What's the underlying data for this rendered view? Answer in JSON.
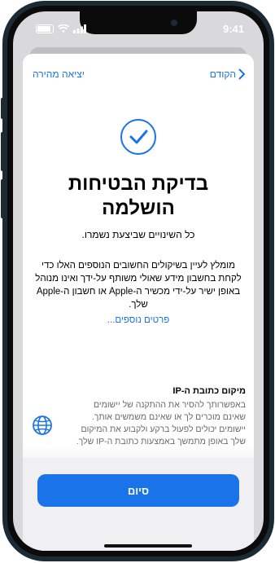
{
  "status_bar": {
    "time": "9:41"
  },
  "nav": {
    "back_label": "הקודם",
    "quick_exit_label": "יציאה מהירה"
  },
  "main": {
    "title_line1": "בדיקת הבטיחות",
    "title_line2": "הושלמה",
    "subtitle": "כל השינויים שביצעת נשמרו.",
    "body": "מומלץ לעיין בשיקולים החשובים הנוספים האלו כדי לקחת בחשבון מידע שאולי משותף על-ידך ואינו מנוהל באופן ישיר על-ידי מכשיר ה-Apple או חשבון ה-Apple שלך.",
    "more_details_link": "פרטים נוספים..."
  },
  "ip_section": {
    "title": "מיקום כתובת ה-IP",
    "description": "באפשרותך להסיר את ההתקנה של יישומים שאינם מוכרים לך או שאינם משמשים אותך. יישומים יכולים לפעול ברקע ולקבוע את המיקום שלך באופן מתמשך באמצעות כתובת ה-IP שלך."
  },
  "footer": {
    "done_label": "סיום"
  },
  "colors": {
    "accent": "#1a73e8",
    "frame": "#1c2a36",
    "sheet_bg": "#ffffff",
    "bottom_bg": "#f0f0f2"
  }
}
